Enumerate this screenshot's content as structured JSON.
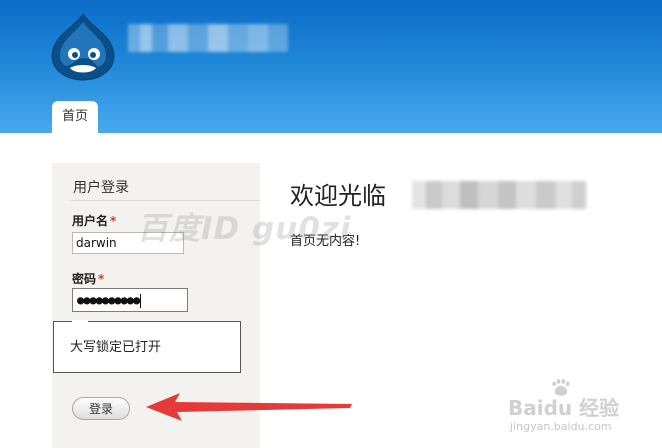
{
  "header": {
    "logo_icon": "drupal-drop-icon",
    "tab_home_label": "首页"
  },
  "login_block": {
    "title": "用户登录",
    "username_label": "用户名",
    "required_mark": "*",
    "username_value": "darwin",
    "password_label": "密码",
    "password_masked_value": "●●●●●●●●●●",
    "capslock_tooltip": "大写锁定已打开",
    "submit_label": "登录"
  },
  "main": {
    "welcome_title": "欢迎光临",
    "empty_message": "首页无内容!"
  },
  "watermarks": {
    "baidu_id": "百度ID gu0zi",
    "baidu_jingyan": "Baidu 经验",
    "baidu_jingyan_url": "jingyan.baidu.com"
  },
  "colors": {
    "header_top": "#0c6cc6",
    "header_bottom": "#49a9ee",
    "sidebar_bg": "#f3f2ef",
    "required": "#d53a2a",
    "annotation_arrow": "#e43a3a"
  }
}
